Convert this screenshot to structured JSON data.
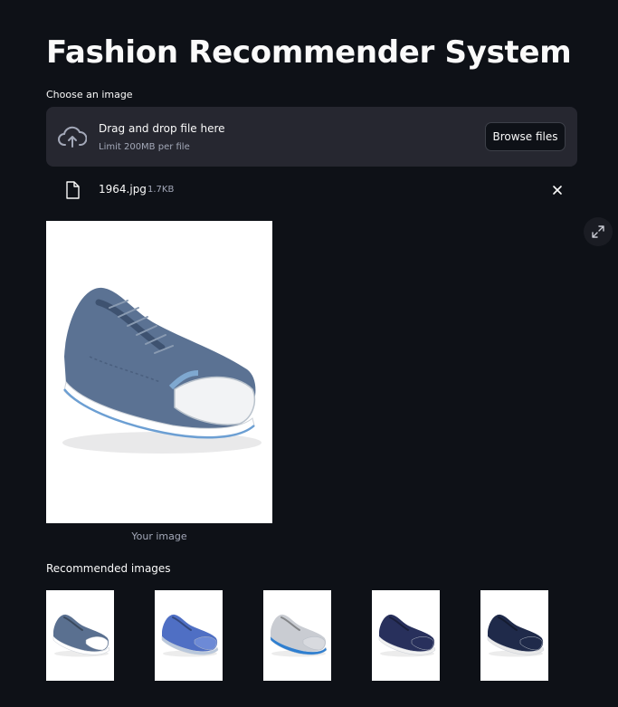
{
  "header": {
    "title": "Fashion Recommender System"
  },
  "uploader": {
    "label": "Choose an image",
    "drag_text": "Drag and drop file here",
    "limit_text": "Limit 200MB per file",
    "browse_label": "Browse files",
    "file": {
      "name": "1964.jpg",
      "size": "1.7KB"
    }
  },
  "preview": {
    "caption": "Your image"
  },
  "recommendations": {
    "label": "Recommended images",
    "items": [
      {
        "shoe_color": "#5a7090",
        "sole": "#ffffff",
        "toe": "#ffffff"
      },
      {
        "shoe_color": "#4f6fc4",
        "sole": "#b9c8dc",
        "toe": "#6d8ad6"
      },
      {
        "shoe_color": "#c9ccd2",
        "sole": "#2f7fd0",
        "toe": "#d8dadf"
      },
      {
        "shoe_color": "#28305c",
        "sole": "#f2f2f2",
        "toe": "#28305c"
      },
      {
        "shoe_color": "#1f2a4a",
        "sole": "#e9e9e9",
        "toe": "#1f2a4a"
      }
    ]
  },
  "colors": {
    "background": "#0e1117",
    "panel": "#262730",
    "muted_text": "#a3a8b8"
  },
  "icons": [
    "cloud-upload-icon",
    "file-icon",
    "close-icon",
    "fullscreen-icon"
  ]
}
